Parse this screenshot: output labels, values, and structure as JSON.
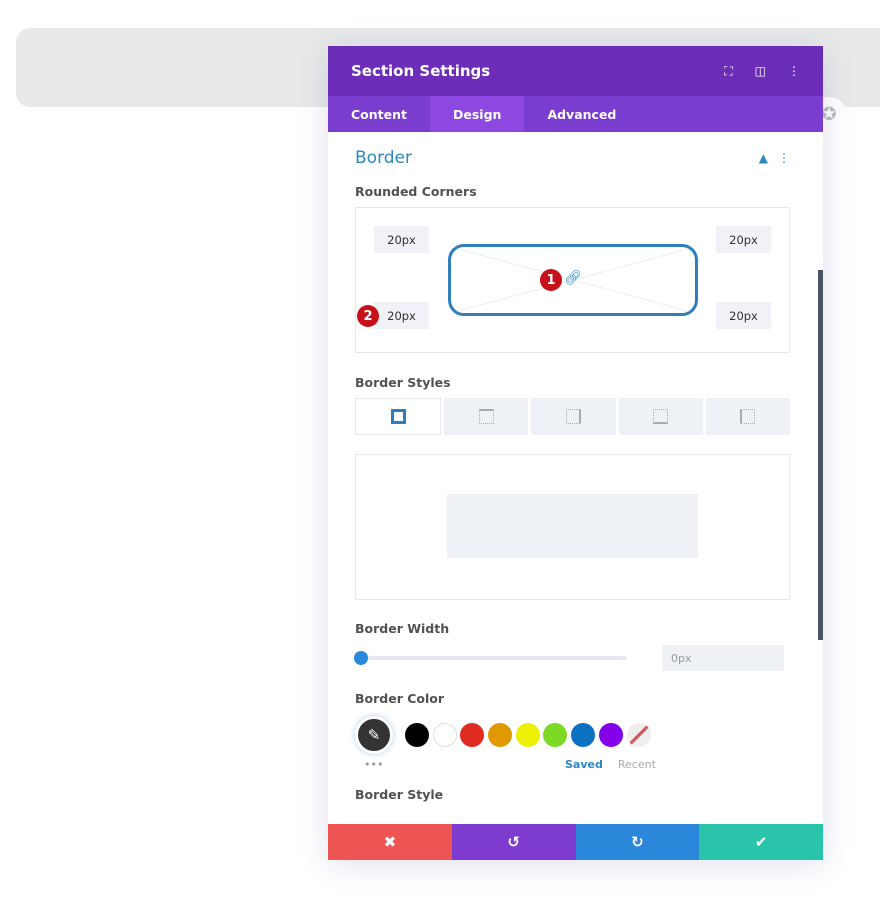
{
  "modal": {
    "title": "Section Settings",
    "header_icons": [
      "fullscreen-icon",
      "split-view-icon",
      "more-icon"
    ],
    "tabs": [
      {
        "label": "Content"
      },
      {
        "label": "Design",
        "active": true
      },
      {
        "label": "Advanced"
      }
    ]
  },
  "border": {
    "section_title": "Border",
    "rounded_label": "Rounded Corners",
    "corners": {
      "top_left": "20px",
      "top_right": "20px",
      "bottom_left": "20px",
      "bottom_right": "20px"
    },
    "badges": [
      "1",
      "2"
    ],
    "styles_label": "Border Styles",
    "width_label": "Border Width",
    "width_value": "0px",
    "width_fraction": 0,
    "color_label": "Border Color",
    "swatches": [
      "#000000",
      "#ffffff",
      "#e02b20",
      "#e09900",
      "#edf000",
      "#7cda24",
      "#0c71c3",
      "#8300e9"
    ],
    "saved": "Saved",
    "recent": "Recent",
    "style_label": "Border Style"
  },
  "footer": {
    "icons": [
      "close-icon",
      "undo-icon",
      "redo-icon",
      "check-icon"
    ],
    "colors": [
      "#ef5555",
      "#7e3bd0",
      "#2b87da",
      "#29c4a9"
    ]
  }
}
